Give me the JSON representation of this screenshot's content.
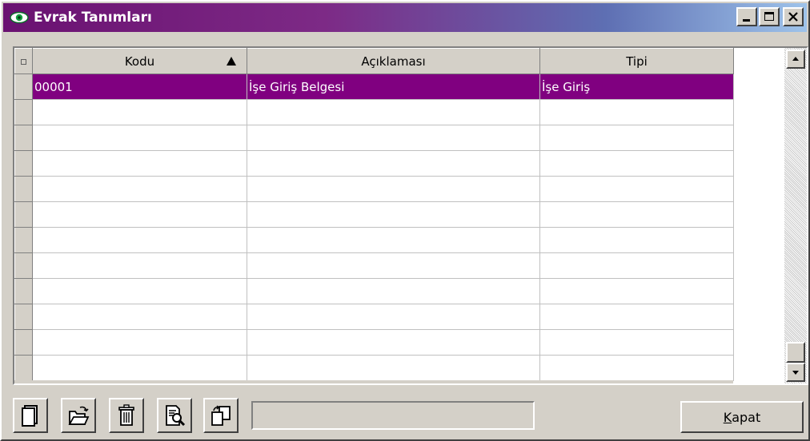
{
  "window": {
    "title": "Evrak Tanımları",
    "controls": [
      "minimize",
      "maximize",
      "close"
    ]
  },
  "grid": {
    "columns": [
      {
        "label": "Kodu",
        "sort": "ascending"
      },
      {
        "label": "Açıklaması"
      },
      {
        "label": "Tipi"
      }
    ],
    "rows": [
      {
        "kodu": "00001",
        "aciklamasi": "İşe Giriş Belgesi",
        "tipi": "İşe Giriş",
        "selected": true
      },
      {
        "kodu": "",
        "aciklamasi": "",
        "tipi": ""
      },
      {
        "kodu": "",
        "aciklamasi": "",
        "tipi": ""
      },
      {
        "kodu": "",
        "aciklamasi": "",
        "tipi": ""
      },
      {
        "kodu": "",
        "aciklamasi": "",
        "tipi": ""
      },
      {
        "kodu": "",
        "aciklamasi": "",
        "tipi": ""
      },
      {
        "kodu": "",
        "aciklamasi": "",
        "tipi": ""
      },
      {
        "kodu": "",
        "aciklamasi": "",
        "tipi": ""
      },
      {
        "kodu": "",
        "aciklamasi": "",
        "tipi": ""
      },
      {
        "kodu": "",
        "aciklamasi": "",
        "tipi": ""
      },
      {
        "kodu": "",
        "aciklamasi": "",
        "tipi": ""
      },
      {
        "kodu": "",
        "aciklamasi": "",
        "tipi": ""
      }
    ]
  },
  "toolbar": {
    "icons": [
      "new-document-icon",
      "open-folder-icon",
      "trash-icon",
      "preview-icon",
      "copy-icon"
    ],
    "status_value": ""
  },
  "buttons": {
    "close_label_accel": "K",
    "close_label_rest": "apat"
  },
  "colors": {
    "title_gradient_start": "#6a1171",
    "title_gradient_end": "#9ec3ea",
    "selection": "#800080",
    "face": "#d4d0c8"
  }
}
